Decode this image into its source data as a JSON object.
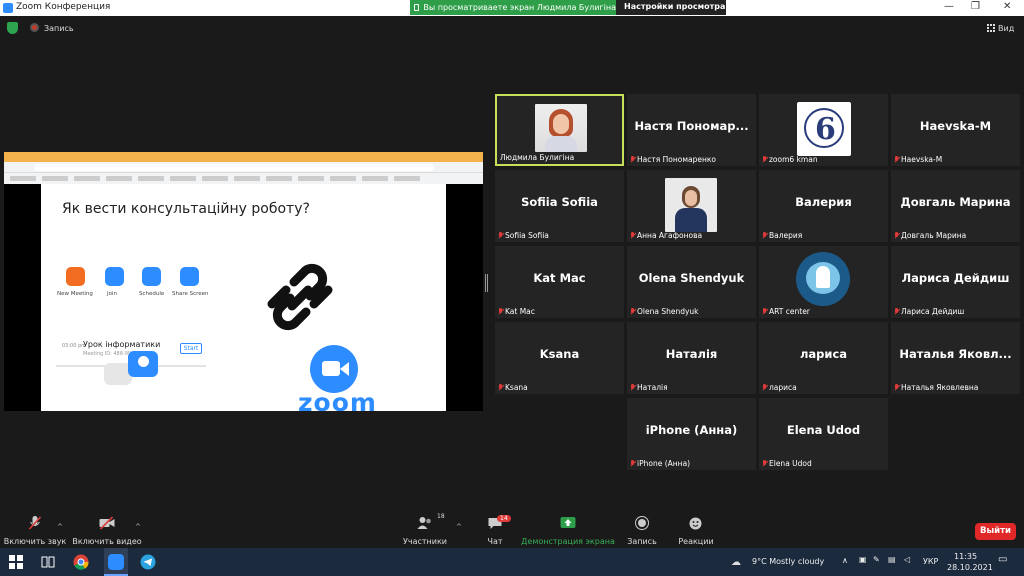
{
  "window": {
    "title": "Zoom Конференция"
  },
  "share_banner": {
    "text": "Вы просматриваете экран Людмила Булигіна",
    "settings": "Настройки просмотра"
  },
  "top": {
    "record_label": "Запись",
    "view_label": "Вид"
  },
  "slide": {
    "heading": "Як вести консультаційну роботу?",
    "buttons": [
      "New Meeting",
      "Join",
      "Schedule",
      "Share Screen"
    ],
    "meeting_time": "03:00 pm",
    "meeting_title": "Урок інформатики",
    "meeting_id": "Meeting ID: 488-996-7411",
    "start_label": "Start",
    "logo_text": "zoom"
  },
  "participants": [
    {
      "display": "",
      "label": "Людмила Булигіна",
      "active": true,
      "photo": "woman-portrait",
      "muted": false
    },
    {
      "display": "Настя Пономар...",
      "label": "Настя Пономаренко",
      "muted": true
    },
    {
      "display": "",
      "label": "zoom6 kman",
      "photo": "school-logo",
      "muted": true
    },
    {
      "display": "Haevska-M",
      "label": "Haevska-M",
      "muted": true
    },
    {
      "display": "Sofiia Sofiia",
      "label": "Sofiia Sofiia",
      "muted": true
    },
    {
      "display": "",
      "label": "Анна Агафонова",
      "photo": "woman-portrait-2",
      "muted": true
    },
    {
      "display": "Валерия",
      "label": "Валерия",
      "muted": true
    },
    {
      "display": "Довгаль Марина",
      "label": "Довгаль Марина",
      "muted": true
    },
    {
      "display": "Kat Mac",
      "label": "Kat Mac",
      "muted": true
    },
    {
      "display": "Olena Shendyuk",
      "label": "Olena Shendyuk",
      "muted": true
    },
    {
      "display": "",
      "label": "ART center",
      "photo": "art-center-logo",
      "muted": true
    },
    {
      "display": "Лариса Дейдиш",
      "label": "Лариса Дейдиш",
      "muted": true
    },
    {
      "display": "Ksana",
      "label": "Ksana",
      "muted": true
    },
    {
      "display": "Наталія",
      "label": "Наталія",
      "muted": true
    },
    {
      "display": "лариса",
      "label": "лариса",
      "muted": true
    },
    {
      "display": "Наталья Яковл...",
      "label": "Наталья Яковлевна",
      "muted": true
    },
    {
      "display": "iPhone (Анна)",
      "label": "iPhone (Анна)",
      "muted": true
    },
    {
      "display": "Elena Udod",
      "label": "Elena Udod",
      "muted": true
    }
  ],
  "toolbar": {
    "audio": "Включить звук",
    "video": "Включить видео",
    "participants": "Участники",
    "participants_count": "18",
    "chat": "Чат",
    "chat_badge": "14",
    "share": "Демонстрация экрана",
    "record": "Запись",
    "reactions": "Реакции",
    "leave": "Выйти"
  },
  "taskbar": {
    "weather": "9°C  Mostly cloudy",
    "lang": "УКР",
    "time": "11:35",
    "date": "28.10.2021"
  },
  "colors": {
    "active_border": "#c6e058",
    "share_green": "#2e9e49",
    "leave_red": "#e02828",
    "zoom_blue": "#2d8cff"
  }
}
